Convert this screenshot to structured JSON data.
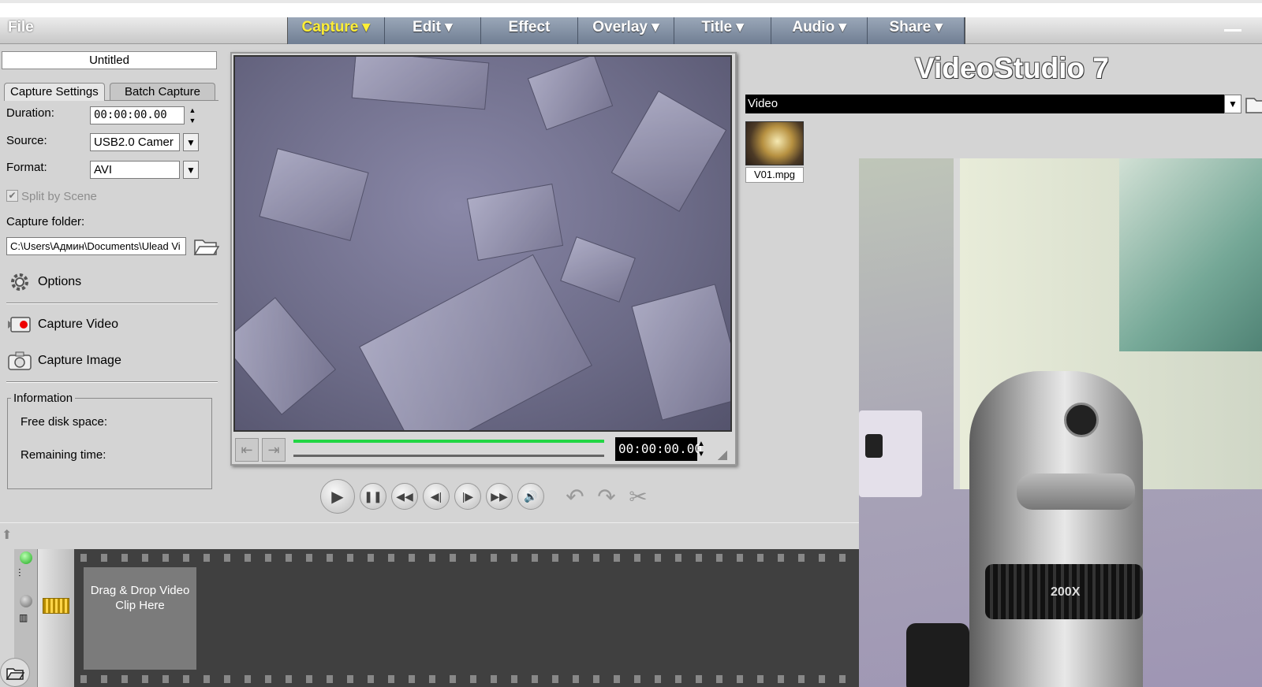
{
  "menu": {
    "file": "File",
    "steps": [
      "Capture ▾",
      "Edit ▾",
      "Effect",
      "Overlay ▾",
      "Title ▾",
      "Audio ▾",
      "Share ▾"
    ]
  },
  "project": {
    "title": "Untitled"
  },
  "capture": {
    "tabs": [
      "Capture Settings",
      "Batch Capture"
    ],
    "duration_label": "Duration:",
    "duration_value": "00:00:00.00",
    "source_label": "Source:",
    "source_value": "USB2.0 Camer",
    "format_label": "Format:",
    "format_value": "AVI",
    "split_by_scene": "Split by Scene",
    "split_checked": true,
    "folder_label": "Capture folder:",
    "folder_value": "C:\\Users\\Админ\\Documents\\Ulead Vi",
    "options": "Options",
    "capture_video": "Capture Video",
    "capture_image": "Capture Image"
  },
  "information": {
    "title": "Information",
    "free_disk": "Free disk space:",
    "remaining": "Remaining time:"
  },
  "preview": {
    "timecode": "00:00:00.00",
    "progress_fraction": 1.0
  },
  "library": {
    "brand": "VideoStudio 7",
    "category": "Video",
    "clips": [
      {
        "name": "V01.mpg"
      }
    ]
  },
  "webcam": {
    "zoom_label": "200X"
  },
  "timeline": {
    "drop_text": "Drag & Drop Video Clip Here"
  },
  "colors": {
    "accent": "#ffef37",
    "progress": "#22d644"
  }
}
